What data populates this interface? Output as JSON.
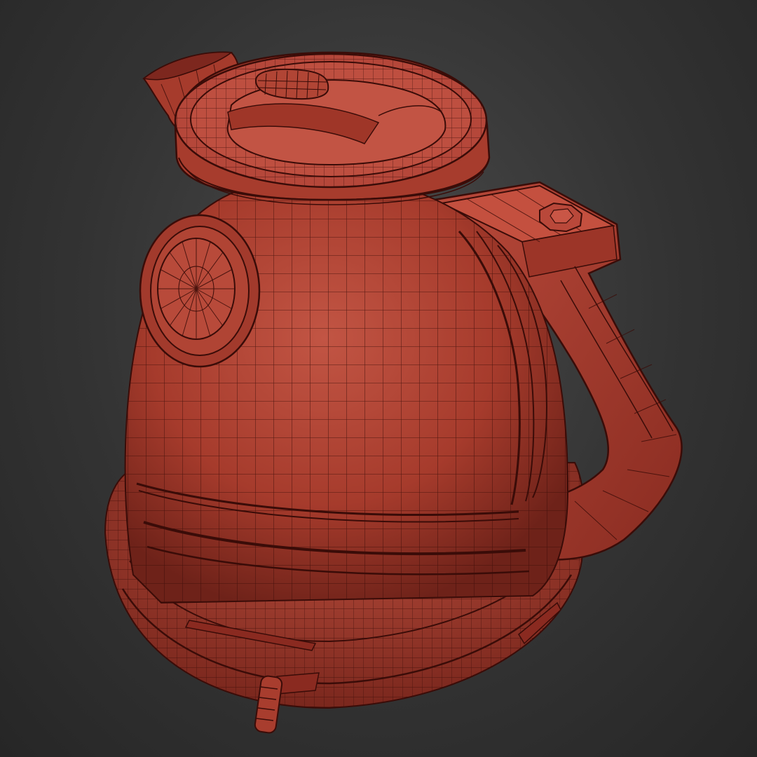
{
  "viewport": {
    "background": "#333333",
    "object": {
      "name": "kettle-wireframe-model",
      "shaded_color": "#b4402f",
      "wire_color": "#3a0c08"
    }
  }
}
